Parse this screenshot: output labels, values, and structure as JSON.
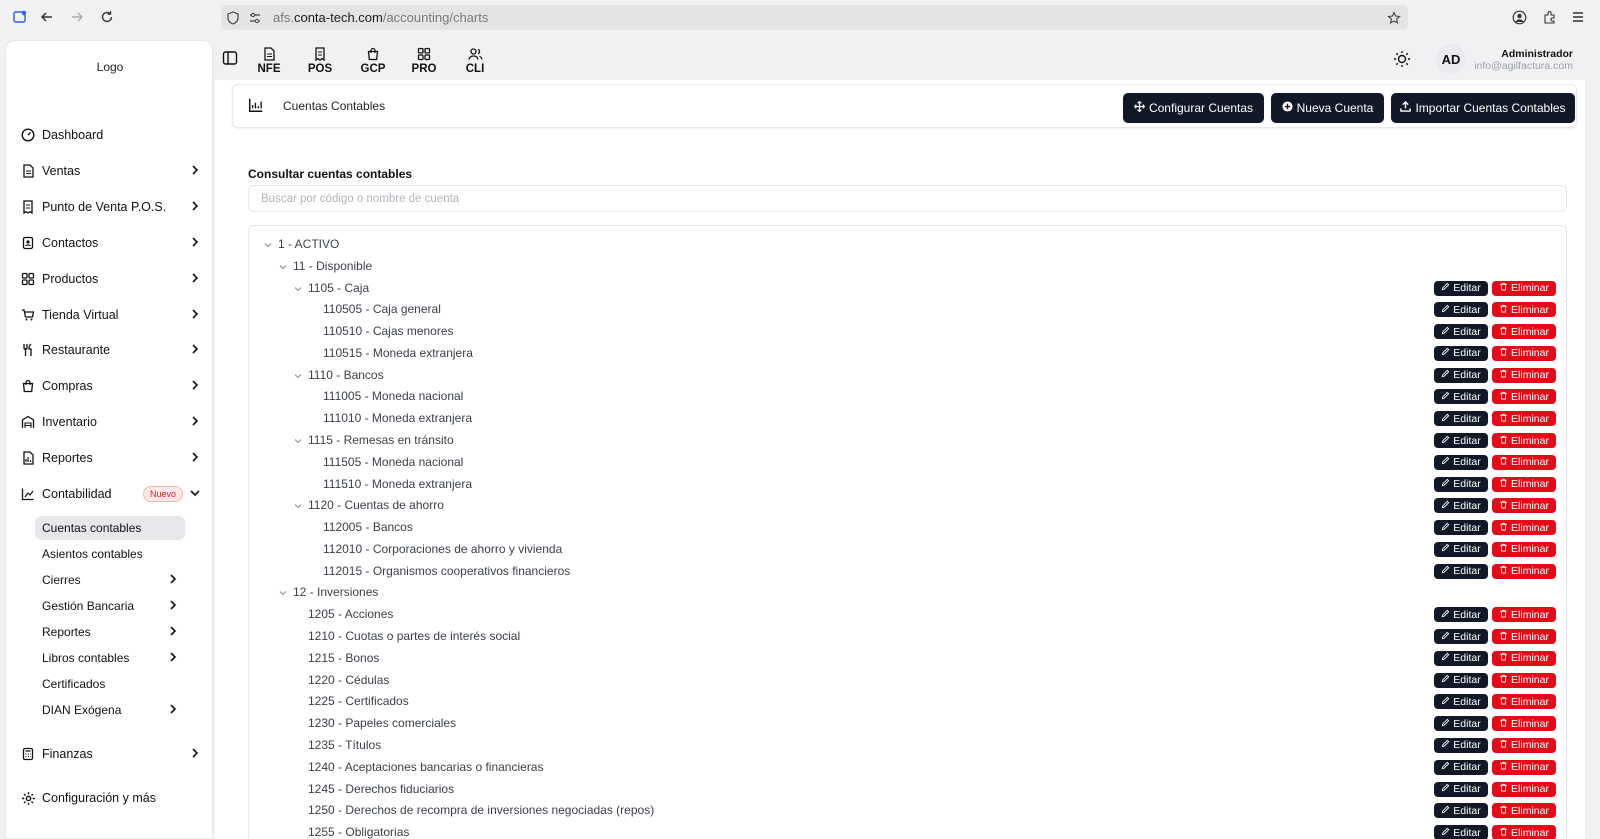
{
  "browser": {
    "url_prefix": "afs.",
    "url_domain": "conta-tech.com",
    "url_path": "/accounting/charts"
  },
  "sidebar": {
    "logo": "Logo",
    "items": [
      {
        "label": "Dashboard",
        "icon": "dashboard-icon"
      },
      {
        "label": "Ventas",
        "icon": "document-icon"
      },
      {
        "label": "Punto de Venta P.O.S.",
        "icon": "receipt-icon"
      },
      {
        "label": "Contactos",
        "icon": "contacts-icon"
      },
      {
        "label": "Productos",
        "icon": "grid-icon"
      },
      {
        "label": "Tienda Virtual",
        "icon": "cart-icon"
      },
      {
        "label": "Restaurante",
        "icon": "utensils-icon"
      },
      {
        "label": "Compras",
        "icon": "bag-icon"
      },
      {
        "label": "Inventario",
        "icon": "warehouse-icon"
      },
      {
        "label": "Reportes",
        "icon": "report-icon"
      },
      {
        "label": "Contabilidad",
        "icon": "chart-icon",
        "badge": "Nuevo"
      }
    ],
    "sub_items": [
      {
        "label": "Cuentas contables"
      },
      {
        "label": "Asientos contables"
      },
      {
        "label": "Cierres"
      },
      {
        "label": "Gestión Bancaria"
      },
      {
        "label": "Reportes"
      },
      {
        "label": "Libros contables"
      },
      {
        "label": "Certificados"
      },
      {
        "label": "DIAN Exógena"
      }
    ],
    "bottom_items": [
      {
        "label": "Finanzas",
        "icon": "calculator-icon"
      },
      {
        "label": "Configuración y más",
        "icon": "gear-icon"
      }
    ]
  },
  "modules": [
    "NFE",
    "POS",
    "GCP",
    "PRO",
    "CLI"
  ],
  "user": {
    "initials": "AD",
    "name": "Administrador",
    "email": "info@agilfactura.com"
  },
  "header": {
    "title": "Cuentas Contables",
    "btn_configure": "Configurar Cuentas",
    "btn_new": "Nueva Cuenta",
    "btn_import": "Importar Cuentas Contables"
  },
  "search": {
    "label": "Consultar cuentas contables",
    "placeholder": "Buscar por código o nombre de cuenta"
  },
  "actions": {
    "edit": "Editar",
    "delete": "Eliminar"
  },
  "tree": [
    {
      "label": "1 - ACTIVO",
      "level": 0,
      "expanded": true,
      "actions": false
    },
    {
      "label": "11 - Disponible",
      "level": 1,
      "expanded": true,
      "actions": false
    },
    {
      "label": "1105 - Caja",
      "level": 2,
      "expanded": true,
      "actions": true
    },
    {
      "label": "110505 - Caja general",
      "level": 3,
      "actions": true
    },
    {
      "label": "110510 - Cajas menores",
      "level": 3,
      "actions": true
    },
    {
      "label": "110515 - Moneda extranjera",
      "level": 3,
      "actions": true
    },
    {
      "label": "1110 - Bancos",
      "level": 2,
      "expanded": true,
      "actions": true
    },
    {
      "label": "111005 - Moneda nacional",
      "level": 3,
      "actions": true
    },
    {
      "label": "111010 - Moneda extranjera",
      "level": 3,
      "actions": true
    },
    {
      "label": "1115 - Remesas en tránsito",
      "level": 2,
      "expanded": true,
      "actions": true
    },
    {
      "label": "111505 - Moneda nacional",
      "level": 3,
      "actions": true
    },
    {
      "label": "111510 - Moneda extranjera",
      "level": 3,
      "actions": true
    },
    {
      "label": "1120 - Cuentas de ahorro",
      "level": 2,
      "expanded": true,
      "actions": true
    },
    {
      "label": "112005 - Bancos",
      "level": 3,
      "actions": true
    },
    {
      "label": "112010 - Corporaciones de ahorro y vivienda",
      "level": 3,
      "actions": true
    },
    {
      "label": "112015 - Organismos cooperativos financieros",
      "level": 3,
      "actions": true
    },
    {
      "label": "12 - Inversiones",
      "level": 1,
      "expanded": true,
      "actions": false
    },
    {
      "label": "1205 - Acciones",
      "level": 2,
      "actions": true
    },
    {
      "label": "1210 - Cuotas o partes de interés social",
      "level": 2,
      "actions": true
    },
    {
      "label": "1215 - Bonos",
      "level": 2,
      "actions": true
    },
    {
      "label": "1220 - Cédulas",
      "level": 2,
      "actions": true
    },
    {
      "label": "1225 - Certificados",
      "level": 2,
      "actions": true
    },
    {
      "label": "1230 - Papeles comerciales",
      "level": 2,
      "actions": true
    },
    {
      "label": "1235 - Títulos",
      "level": 2,
      "actions": true
    },
    {
      "label": "1240 - Aceptaciones bancarias o financieras",
      "level": 2,
      "actions": true
    },
    {
      "label": "1245 - Derechos fiduciarios",
      "level": 2,
      "actions": true
    },
    {
      "label": "1250 - Derechos de recompra de inversiones negociadas (repos)",
      "level": 2,
      "actions": true
    },
    {
      "label": "1255 - Obligatorias",
      "level": 2,
      "actions": true
    }
  ]
}
